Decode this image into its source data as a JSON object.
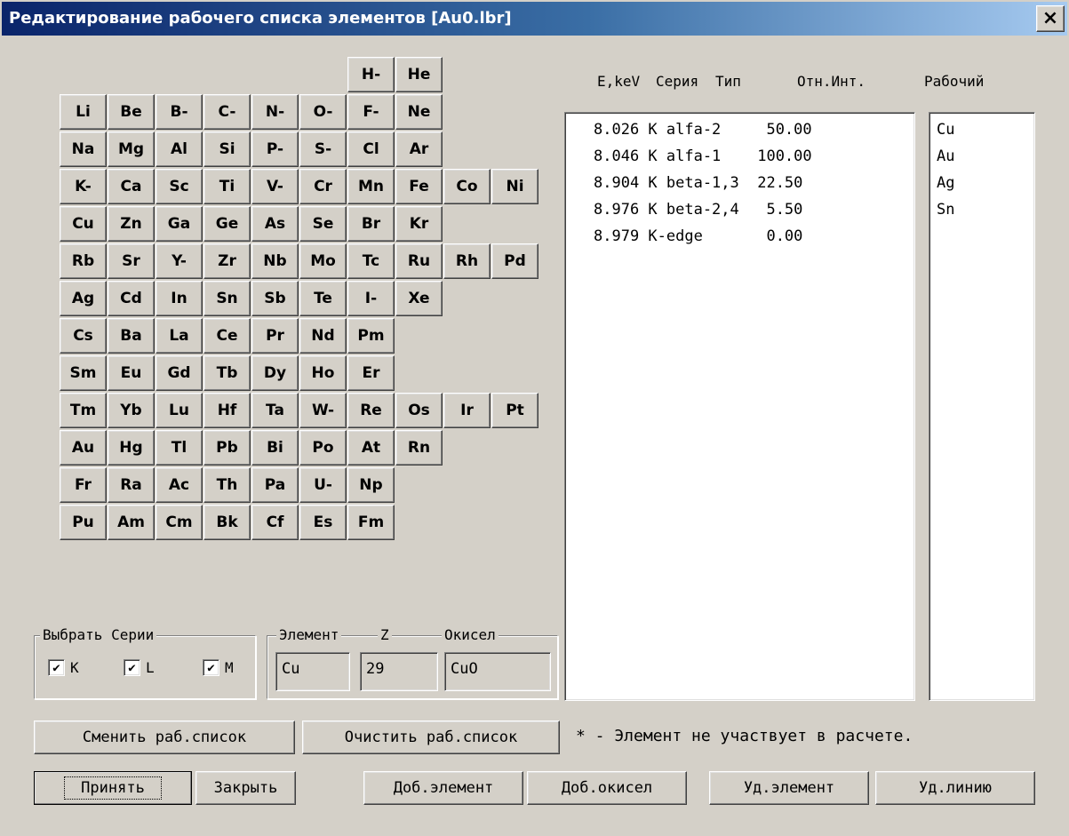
{
  "window": {
    "title": "Редактирование рабочего списка элементов [Au0.lbr]",
    "close_glyph": "×"
  },
  "periodic_table": {
    "rows": [
      [
        {
          "label": "H-",
          "col": 7
        },
        {
          "label": "He",
          "col": 8
        }
      ],
      [
        {
          "label": "Li",
          "col": 1
        },
        {
          "label": "Be",
          "col": 2
        },
        {
          "label": "B-",
          "col": 3
        },
        {
          "label": "C-",
          "col": 4
        },
        {
          "label": "N-",
          "col": 5
        },
        {
          "label": "O-",
          "col": 6
        },
        {
          "label": "F-",
          "col": 7
        },
        {
          "label": "Ne",
          "col": 8
        }
      ],
      [
        {
          "label": "Na",
          "col": 1
        },
        {
          "label": "Mg",
          "col": 2
        },
        {
          "label": "Al",
          "col": 3
        },
        {
          "label": "Si",
          "col": 4
        },
        {
          "label": "P-",
          "col": 5
        },
        {
          "label": "S-",
          "col": 6
        },
        {
          "label": "Cl",
          "col": 7
        },
        {
          "label": "Ar",
          "col": 8
        }
      ],
      [
        {
          "label": "K-",
          "col": 1
        },
        {
          "label": "Ca",
          "col": 2
        },
        {
          "label": "Sc",
          "col": 3
        },
        {
          "label": "Ti",
          "col": 4
        },
        {
          "label": "V-",
          "col": 5
        },
        {
          "label": "Cr",
          "col": 6
        },
        {
          "label": "Mn",
          "col": 7
        },
        {
          "label": "Fe",
          "col": 8
        },
        {
          "label": "Co",
          "col": 9
        },
        {
          "label": "Ni",
          "col": 10
        }
      ],
      [
        {
          "label": "Cu",
          "col": 1
        },
        {
          "label": "Zn",
          "col": 2
        },
        {
          "label": "Ga",
          "col": 3
        },
        {
          "label": "Ge",
          "col": 4
        },
        {
          "label": "As",
          "col": 5
        },
        {
          "label": "Se",
          "col": 6
        },
        {
          "label": "Br",
          "col": 7
        },
        {
          "label": "Kr",
          "col": 8
        }
      ],
      [
        {
          "label": "Rb",
          "col": 1
        },
        {
          "label": "Sr",
          "col": 2
        },
        {
          "label": "Y-",
          "col": 3
        },
        {
          "label": "Zr",
          "col": 4
        },
        {
          "label": "Nb",
          "col": 5
        },
        {
          "label": "Mo",
          "col": 6
        },
        {
          "label": "Tc",
          "col": 7
        },
        {
          "label": "Ru",
          "col": 8
        },
        {
          "label": "Rh",
          "col": 9
        },
        {
          "label": "Pd",
          "col": 10
        }
      ],
      [
        {
          "label": "Ag",
          "col": 1
        },
        {
          "label": "Cd",
          "col": 2
        },
        {
          "label": "In",
          "col": 3
        },
        {
          "label": "Sn",
          "col": 4
        },
        {
          "label": "Sb",
          "col": 5
        },
        {
          "label": "Te",
          "col": 6
        },
        {
          "label": "I-",
          "col": 7
        },
        {
          "label": "Xe",
          "col": 8
        }
      ],
      [
        {
          "label": "Cs",
          "col": 1
        },
        {
          "label": "Ba",
          "col": 2
        },
        {
          "label": "La",
          "col": 3
        },
        {
          "label": "Ce",
          "col": 4
        },
        {
          "label": "Pr",
          "col": 5
        },
        {
          "label": "Nd",
          "col": 6
        },
        {
          "label": "Pm",
          "col": 7
        }
      ],
      [
        {
          "label": "Sm",
          "col": 1
        },
        {
          "label": "Eu",
          "col": 2
        },
        {
          "label": "Gd",
          "col": 3
        },
        {
          "label": "Tb",
          "col": 4
        },
        {
          "label": "Dy",
          "col": 5
        },
        {
          "label": "Ho",
          "col": 6
        },
        {
          "label": "Er",
          "col": 7
        }
      ],
      [
        {
          "label": "Tm",
          "col": 1
        },
        {
          "label": "Yb",
          "col": 2
        },
        {
          "label": "Lu",
          "col": 3
        },
        {
          "label": "Hf",
          "col": 4
        },
        {
          "label": "Ta",
          "col": 5
        },
        {
          "label": "W-",
          "col": 6
        },
        {
          "label": "Re",
          "col": 7
        },
        {
          "label": "Os",
          "col": 8
        },
        {
          "label": "Ir",
          "col": 9
        },
        {
          "label": "Pt",
          "col": 10
        }
      ],
      [
        {
          "label": "Au",
          "col": 1
        },
        {
          "label": "Hg",
          "col": 2
        },
        {
          "label": "Tl",
          "col": 3
        },
        {
          "label": "Pb",
          "col": 4
        },
        {
          "label": "Bi",
          "col": 5
        },
        {
          "label": "Po",
          "col": 6
        },
        {
          "label": "At",
          "col": 7
        },
        {
          "label": "Rn",
          "col": 8
        }
      ],
      [
        {
          "label": "Fr",
          "col": 1
        },
        {
          "label": "Ra",
          "col": 2
        },
        {
          "label": "Ac",
          "col": 3
        },
        {
          "label": "Th",
          "col": 4
        },
        {
          "label": "Pa",
          "col": 5
        },
        {
          "label": "U-",
          "col": 6
        },
        {
          "label": "Np",
          "col": 7
        }
      ],
      [
        {
          "label": "Pu",
          "col": 1
        },
        {
          "label": "Am",
          "col": 2
        },
        {
          "label": "Cm",
          "col": 3
        },
        {
          "label": "Bk",
          "col": 4
        },
        {
          "label": "Cf",
          "col": 5
        },
        {
          "label": "Es",
          "col": 6
        },
        {
          "label": "Fm",
          "col": 7
        }
      ]
    ]
  },
  "lines_header": {
    "energy": "E,keV",
    "series": "Серия",
    "type": "Тип",
    "rel_int": "Отн.Инт.",
    "working": "Рабочий"
  },
  "lines_list": [
    "8.026 K alfa-2     50.00",
    "8.046 K alfa-1    100.00",
    "8.904 K beta-1,3  22.50",
    "8.976 K beta-2,4   5.50",
    "8.979 K-edge       0.00"
  ],
  "working_list": [
    "Cu",
    "Au",
    "Ag",
    "Sn"
  ],
  "series_group": {
    "title": "Выбрать Серии",
    "options": [
      {
        "label": "K",
        "checked": true
      },
      {
        "label": "L",
        "checked": true
      },
      {
        "label": "M",
        "checked": true
      }
    ],
    "check_glyph": "✔"
  },
  "element_group": {
    "label_element": "Элемент",
    "label_z": "Z",
    "label_oxide": "Окисел",
    "element": "Cu",
    "z": "29",
    "oxide": "CuO"
  },
  "buttons": {
    "change_list": "Сменить раб.список",
    "clear_list": "Очистить раб.список",
    "accept": "Принять",
    "close": "Закрыть",
    "add_element": "Доб.элемент",
    "add_oxide": "Доб.окисел",
    "del_element": "Уд.элемент",
    "del_line": "Уд.линию"
  },
  "note": "* - Элемент не участвует в расчете."
}
